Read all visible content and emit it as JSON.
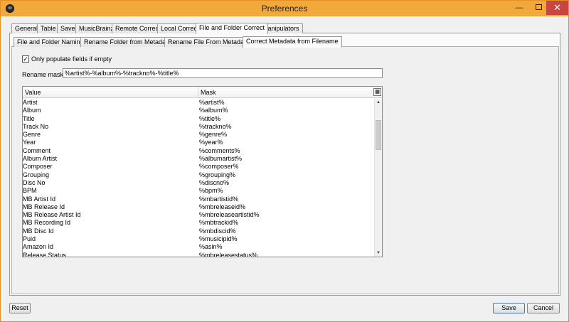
{
  "window": {
    "title": "Preferences",
    "minimize_glyph": "—",
    "close_glyph": "✕"
  },
  "outer_tabs": [
    {
      "label": "General"
    },
    {
      "label": "Table"
    },
    {
      "label": "Save"
    },
    {
      "label": "MusicBrainz"
    },
    {
      "label": "Remote Correct"
    },
    {
      "label": "Local Correct"
    },
    {
      "label": "File and Folder Correct",
      "active": true
    },
    {
      "label": "Manipulators"
    }
  ],
  "inner_tabs": [
    {
      "label": "File and Folder Naming"
    },
    {
      "label": "Rename Folder from Metadata"
    },
    {
      "label": "Rename File From Metadata"
    },
    {
      "label": "Correct Metadata from Filename",
      "active": true
    }
  ],
  "options": {
    "only_populate_label": "Only populate fields if empty",
    "only_populate_checked": true,
    "check_glyph": "✓"
  },
  "rename_mask": {
    "label": "Rename mask:",
    "value": "%artist%-%album%-%trackno%-%title%"
  },
  "table": {
    "columns": [
      "Value",
      "Mask"
    ],
    "chooser_icon": "column-chooser-icon",
    "chooser_glyph": "▦",
    "scroll_up_glyph": "▲",
    "scroll_down_glyph": "▼",
    "rows": [
      {
        "value": "Artist",
        "mask": "%artist%"
      },
      {
        "value": "Album",
        "mask": "%album%"
      },
      {
        "value": "Title",
        "mask": "%title%"
      },
      {
        "value": "Track No",
        "mask": "%trackno%"
      },
      {
        "value": "Genre",
        "mask": "%genre%"
      },
      {
        "value": "Year",
        "mask": "%year%"
      },
      {
        "value": "Comment",
        "mask": "%comments%"
      },
      {
        "value": "Album Artist",
        "mask": "%albumartist%"
      },
      {
        "value": "Composer",
        "mask": "%composer%"
      },
      {
        "value": "Grouping",
        "mask": "%grouping%"
      },
      {
        "value": "Disc No",
        "mask": "%discno%"
      },
      {
        "value": "BPM",
        "mask": "%bpm%"
      },
      {
        "value": "MB Artist Id",
        "mask": "%mbartistid%"
      },
      {
        "value": "MB Release Id",
        "mask": "%mbreleaseid%"
      },
      {
        "value": "MB Release Artist Id",
        "mask": "%mbreleaseartistid%"
      },
      {
        "value": "MB Recording Id",
        "mask": "%mbtrackid%"
      },
      {
        "value": "MB Disc Id",
        "mask": "%mbdiscid%"
      },
      {
        "value": "Puid",
        "mask": "%musicipid%"
      },
      {
        "value": "Amazon Id",
        "mask": "%asin%"
      },
      {
        "value": "Release Status",
        "mask": "%mbreleasestatus%"
      }
    ]
  },
  "buttons": {
    "reset": "Reset",
    "save": "Save",
    "cancel": "Cancel"
  },
  "colors": {
    "titlebar": "#f2a93b",
    "close": "#c7463e"
  }
}
